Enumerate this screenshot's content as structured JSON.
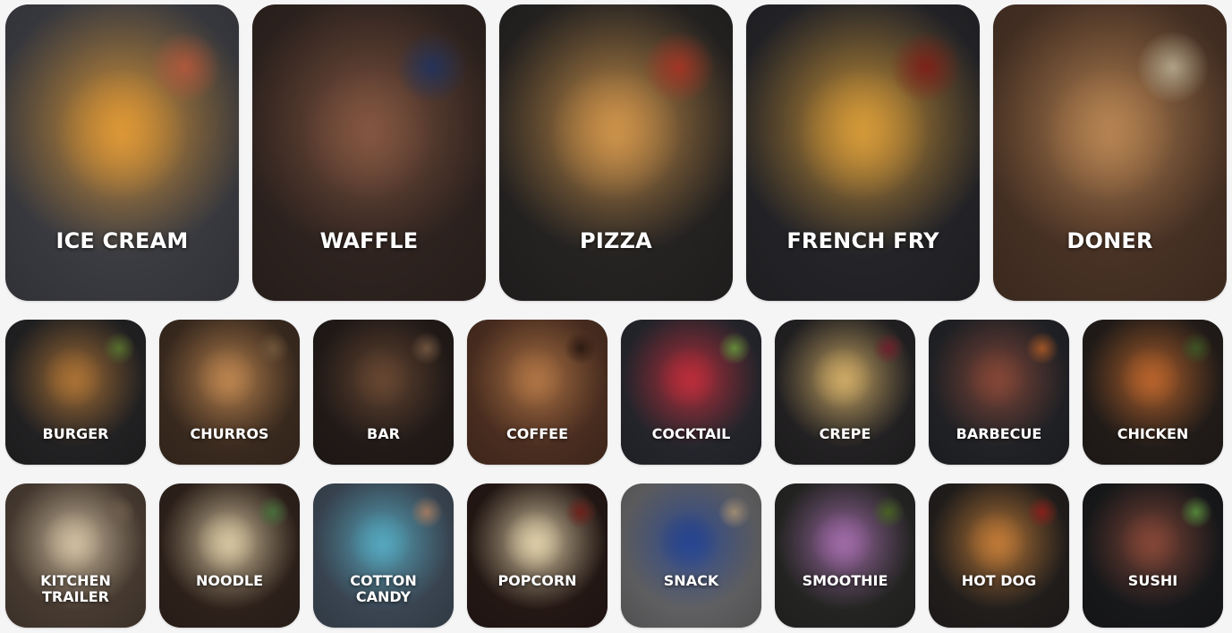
{
  "featured": [
    {
      "label": "ICE CREAM",
      "bg": "#4a4b52",
      "accent": "#e9a03a",
      "accent2": "#d86d4a"
    },
    {
      "label": "WAFFLE",
      "bg": "#3a2c27",
      "accent": "#8a5a44",
      "accent2": "#2e3f6e"
    },
    {
      "label": "PIZZA",
      "bg": "#2f2c2b",
      "accent": "#d79a4e",
      "accent2": "#c9432e"
    },
    {
      "label": "FRENCH FRY",
      "bg": "#2e2e33",
      "accent": "#e0a23c",
      "accent2": "#9b2a1f"
    },
    {
      "label": "DONER",
      "bg": "#5a3e2e",
      "accent": "#c08a56",
      "accent2": "#d9c9a8"
    }
  ],
  "row1": [
    {
      "label": "BURGER",
      "bg": "#2b2a2c",
      "accent": "#b27738",
      "accent2": "#6e8c3a"
    },
    {
      "label": "CHURROS",
      "bg": "#4a3628",
      "accent": "#c48a52",
      "accent2": "#8b6a48"
    },
    {
      "label": "BAR",
      "bg": "#2a211e",
      "accent": "#6b4a34",
      "accent2": "#8c6a50"
    },
    {
      "label": "COFFEE",
      "bg": "#5e3a29",
      "accent": "#b87a48",
      "accent2": "#3a2218"
    },
    {
      "label": "COCKTAIL",
      "bg": "#2f3038",
      "accent": "#c4303e",
      "accent2": "#7fb04a"
    },
    {
      "label": "CREPE",
      "bg": "#2c2a2c",
      "accent": "#d7b26a",
      "accent2": "#8b2a38"
    },
    {
      "label": "BARBECUE",
      "bg": "#2a2b30",
      "accent": "#8a4a3a",
      "accent2": "#c96a30"
    },
    {
      "label": "CHICKEN",
      "bg": "#2b2420",
      "accent": "#c0682e",
      "accent2": "#4e6a2e"
    }
  ],
  "row2": [
    {
      "label": "KITCHEN TRAILER",
      "bg": "#5a4a3e",
      "accent": "#d9c7a8",
      "accent2": "#8a7460"
    },
    {
      "label": "NOODLE",
      "bg": "#3a2a22",
      "accent": "#e0cfa8",
      "accent2": "#5a8a4a"
    },
    {
      "label": "COTTON CANDY",
      "bg": "#4a5868",
      "accent": "#5ab0c8",
      "accent2": "#c89a7a"
    },
    {
      "label": "POPCORN",
      "bg": "#2e1e1a",
      "accent": "#e8d8b0",
      "accent2": "#8a2a22"
    },
    {
      "label": "SNACK",
      "bg": "#7a7a7c",
      "accent": "#2a4a9a",
      "accent2": "#c8b090"
    },
    {
      "label": "SMOOTHIE",
      "bg": "#2e2f2c",
      "accent": "#a870b0",
      "accent2": "#5a7a2e"
    },
    {
      "label": "HOT DOG",
      "bg": "#2a2624",
      "accent": "#c8803a",
      "accent2": "#a82a22"
    },
    {
      "label": "SUSHI",
      "bg": "#1e1f22",
      "accent": "#8a4a3a",
      "accent2": "#6aa84a"
    }
  ]
}
